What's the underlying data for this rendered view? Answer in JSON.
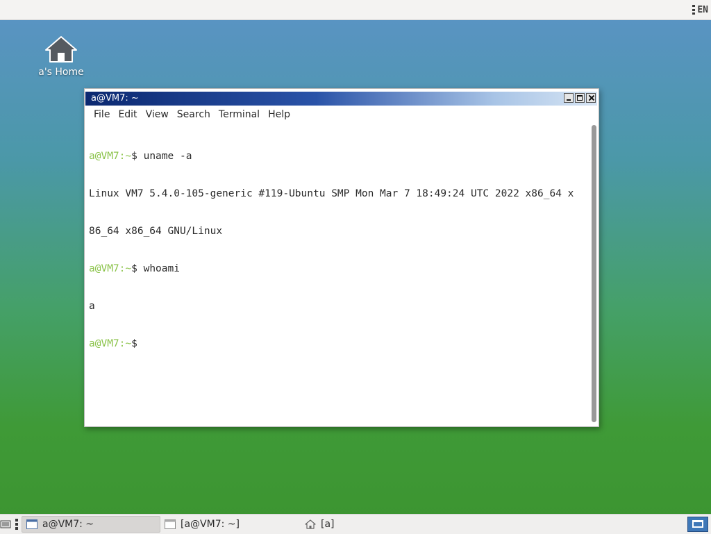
{
  "top_panel": {
    "lang_indicator": "EN"
  },
  "desktop": {
    "icons": [
      {
        "label": "a's Home",
        "icon": "home-icon"
      }
    ]
  },
  "window": {
    "title": "a@VM7: ~",
    "menu": [
      "File",
      "Edit",
      "View",
      "Search",
      "Terminal",
      "Help"
    ],
    "terminal": {
      "prompt_user_host": "a@VM7",
      "prompt_path": ":~",
      "prompt_symbol": "$",
      "lines": [
        {
          "type": "command",
          "command": " uname -a"
        },
        {
          "type": "output",
          "text": "Linux VM7 5.4.0-105-generic #119-Ubuntu SMP Mon Mar 7 18:49:24 UTC 2022 x86_64 x"
        },
        {
          "type": "output",
          "text": "86_64 x86_64 GNU/Linux"
        },
        {
          "type": "command",
          "command": " whoami"
        },
        {
          "type": "output",
          "text": "a"
        },
        {
          "type": "command",
          "command": ""
        }
      ]
    },
    "colors": {
      "prompt": "#8bc34a",
      "title_gradient_start": "#0b2870",
      "title_gradient_end": "#d7e5f4"
    }
  },
  "taskbar": {
    "tasks": [
      {
        "label": "a@VM7: ~",
        "active": true,
        "icon": "window-icon"
      },
      {
        "label": "[a@VM7: ~]",
        "active": false,
        "icon": "window-icon"
      },
      {
        "label": "[a]",
        "active": false,
        "icon": "home-icon"
      }
    ],
    "show_desktop_icon": "show-desktop-icon"
  }
}
